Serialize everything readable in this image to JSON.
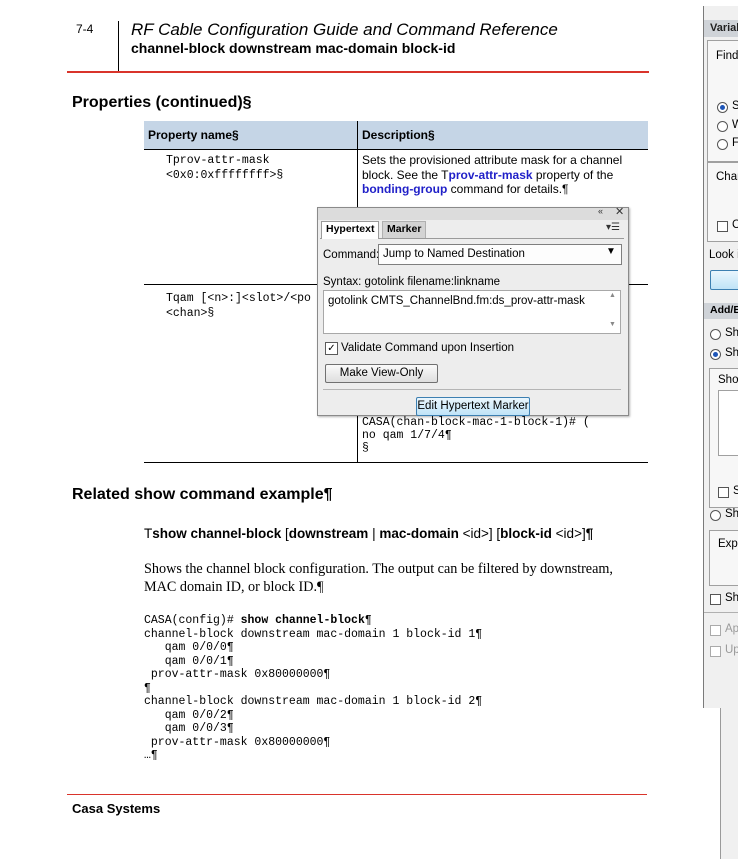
{
  "header": {
    "page_number": "7-4",
    "doc_title": "RF Cable Configuration Guide and Command Reference",
    "section_title": "channel-block downstream mac-domain block-id"
  },
  "properties": {
    "heading": "Properties (continued)§",
    "columns": [
      "Property name§",
      "Description§"
    ],
    "row1": {
      "name_mark": "T",
      "name_lines": [
        "prov-attr-mask",
        "<0x0:0xffffffff>§"
      ],
      "desc_text1": "Sets the provisioned attribute mask for a channel block. See the ",
      "desc_link1_mark": "T",
      "desc_link1": "prov-attr-mask",
      "desc_text2": " property of the ",
      "desc_link2": "bonding-group",
      "desc_text3": " command for details.¶"
    },
    "row2": {
      "name_mark": "T",
      "name_lines": [
        "qam [<n>:]<slot>/<po",
        "<chan>§"
      ],
      "cli_lines": [
        "CASA(chan-block-mac-1-block-1)# (",
        "no qam 1/7/4¶",
        "§"
      ]
    }
  },
  "related": {
    "heading": "Related show command example¶",
    "syntax": {
      "mark": "T",
      "command": "show channel-block",
      "opt_open": " [",
      "kw1": "downstream",
      "sep": " | ",
      "kw2": "mac-domain",
      "arg1": " <id>] [",
      "kw3": "block-id",
      "arg2": " <id>]",
      "end": "¶"
    },
    "paragraph": "Shows the channel block configuration. The output can be filtered by downstream, MAC domain ID, or block ID.¶",
    "cli_prompt": "CASA(config)# ",
    "cli_command": "show channel-block",
    "cli_command_end": "¶",
    "cli_output": "channel-block downstream mac-domain 1 block-id 1¶\n   qam 0/0/0¶\n   qam 0/0/1¶\n prov-attr-mask 0x80000000¶\n¶\nchannel-block downstream mac-domain 1 block-id 2¶\n   qam 0/0/2¶\n   qam 0/0/3¶\n prov-attr-mask 0x80000000¶\n…¶"
  },
  "footer": {
    "company": "Casa Systems"
  },
  "dialog": {
    "collapse_icon": "«",
    "close_icon": "✕",
    "tabs": [
      "Hypertext",
      "Marker"
    ],
    "menu_icon": "▾☰",
    "command_label": "Command:",
    "command_value": "Jump to Named Destination",
    "syntax_label": "Syntax:  gotolink filename:linkname",
    "command_text": "gotolink CMTS_ChannelBnd.fm:ds_prov-attr-mask",
    "validate_label": "Validate Command upon Insertion",
    "validate_checked": true,
    "make_view_only": "Make View-Only",
    "edit_marker": "Edit Hypertext Marker"
  },
  "side_window": {
    "title": "Variab",
    "find_label": "Find",
    "radio_s": "S",
    "radio_w": "W",
    "radio_f": "F",
    "chan_label": "Chan",
    "check_c": "C",
    "look_label": "Look i",
    "add_section": "Add/E",
    "show1": "Sho",
    "show2": "Sho",
    "show_label": "Show",
    "check_s": "S",
    "show3": "Sho",
    "expr_label": "Expr",
    "show4": "Sho",
    "apply": "App",
    "update": "Up"
  }
}
